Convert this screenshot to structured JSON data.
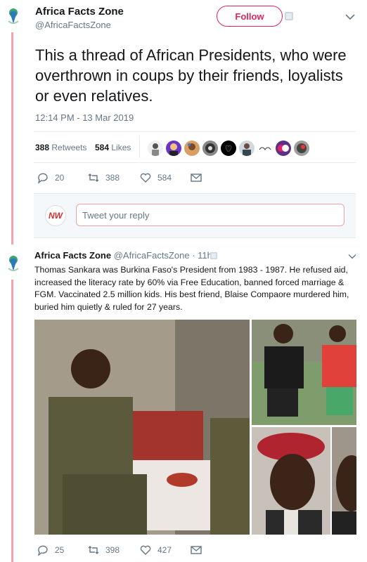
{
  "tweet": {
    "author_name": "Africa Facts Zone",
    "author_handle": "@AfricaFactsZone",
    "follow_label": "Follow",
    "text": "This a thread of African Presidents, who were overthrown in coups by their friends, loyalists or even relatives.",
    "timestamp": "12:14 PM - 13 Mar 2019",
    "retweets_count": "388",
    "retweets_label": "Retweets",
    "likes_count": "584",
    "likes_label": "Likes",
    "actions": {
      "replies": "20",
      "retweets": "388",
      "likes": "584"
    }
  },
  "reply": {
    "placeholder": "Tweet your reply",
    "avatar_text": "NW"
  },
  "reply_tweet": {
    "author_name": "Africa Facts Zone",
    "author_handle": "@AfricaFactsZone",
    "time": "· 11h",
    "text": "Thomas Sankara was Burkina Faso's President from 1983 - 1987. He refused aid, increased the literacy rate by 60% via Free Education, banned forced marriage & FGM. Vaccinated 2.5 million kids. His best friend, Blaise Compaore murdered him, buried him quietly & ruled for 27 years.",
    "actions": {
      "replies": "25",
      "retweets": "398",
      "likes": "427"
    }
  },
  "colors": {
    "accent": "#e0245e",
    "muted": "#657786",
    "thread_line": "#f5a3a8"
  },
  "icons": [
    "logo-icon",
    "chevron-down-icon",
    "reply-icon",
    "retweet-icon",
    "like-icon",
    "dm-icon"
  ]
}
